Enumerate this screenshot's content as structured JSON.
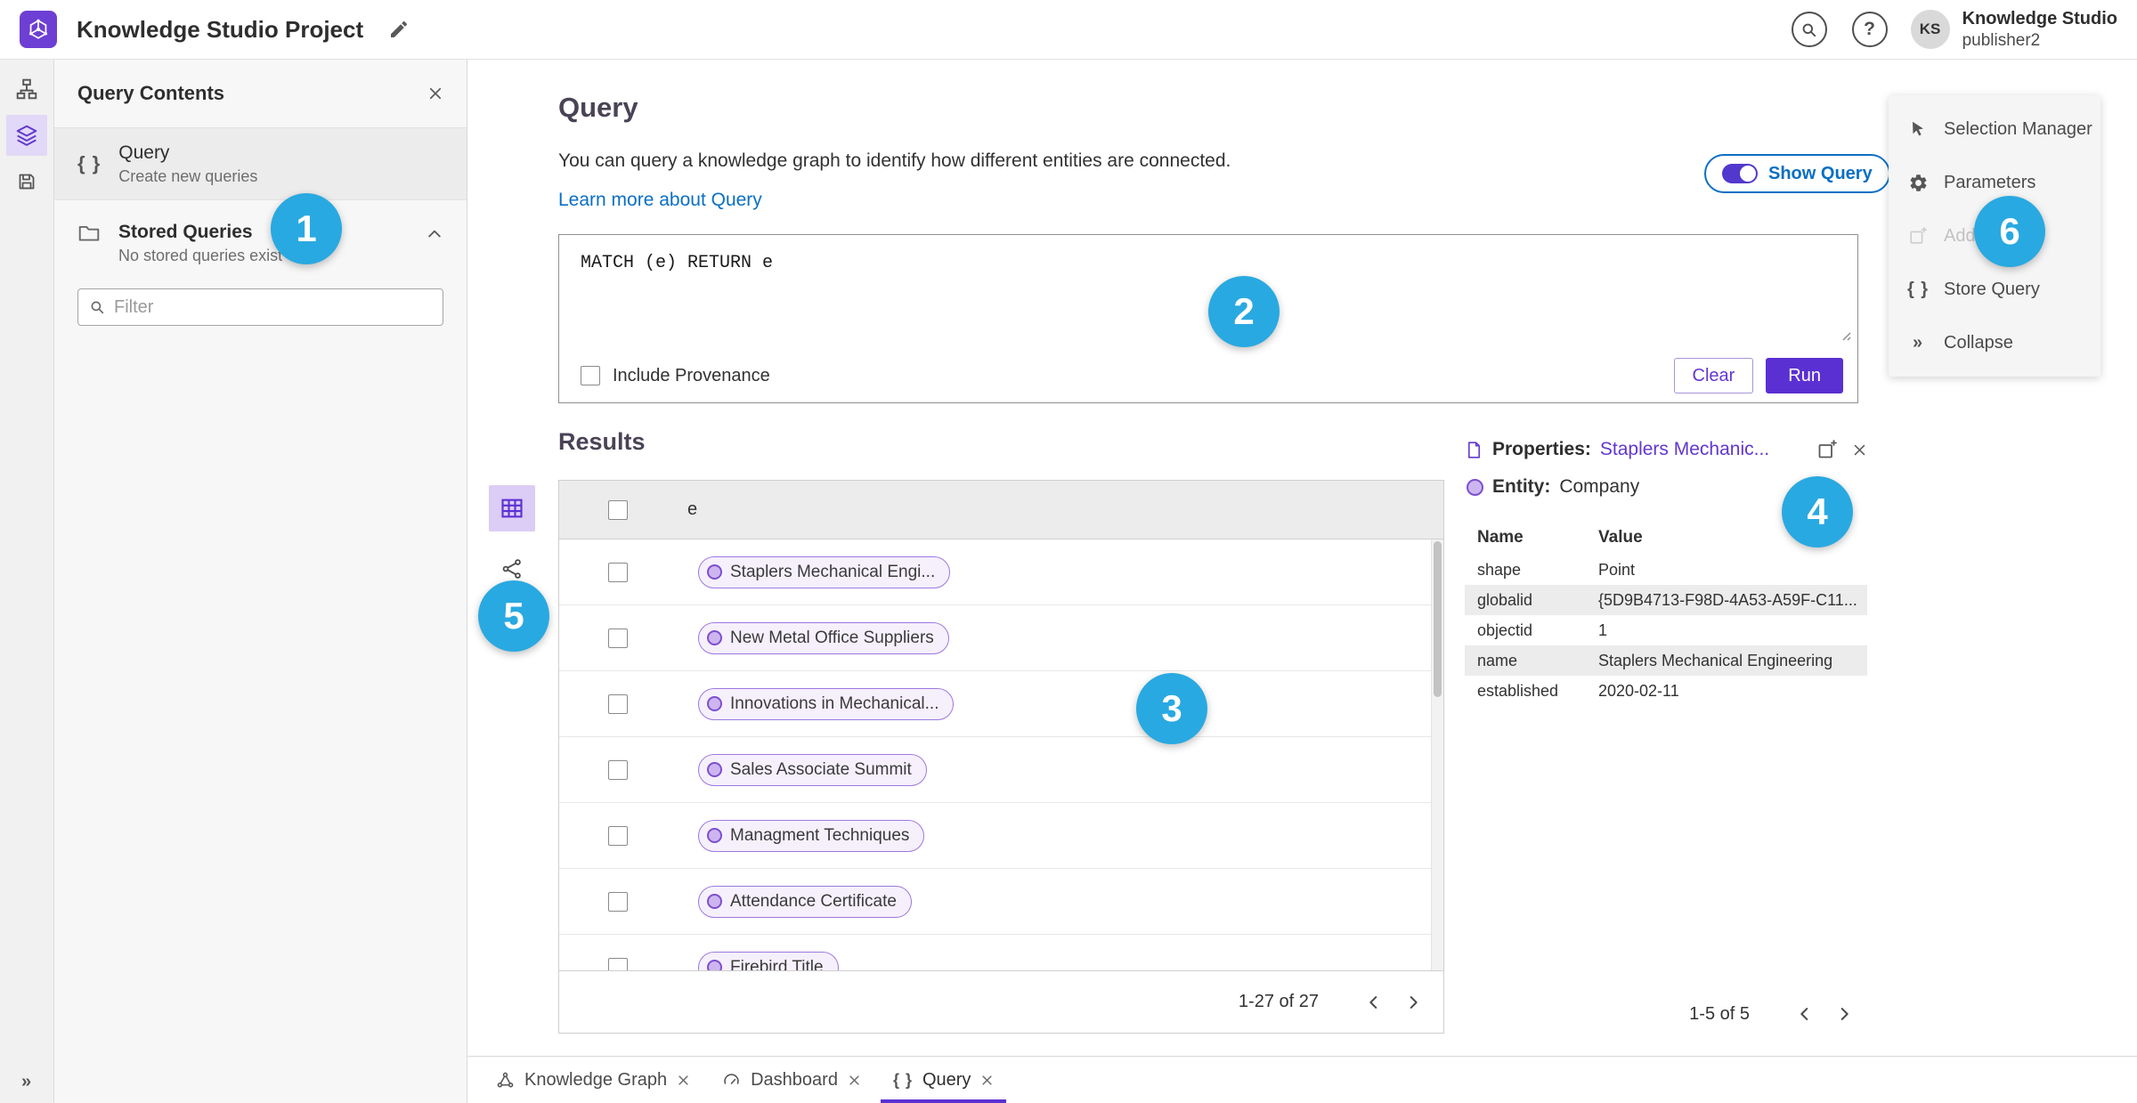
{
  "colors": {
    "accent_purple": "#5b30d2",
    "logo_purple": "#6d3fd4",
    "chip_border": "#9d78e2",
    "chip_background": "#f6f0fd",
    "link_blue": "#0b6fc2",
    "badge_blue": "#29a9e1",
    "panel_gray": "#f7f7f7"
  },
  "icons": {
    "help": "?",
    "braces": "{ }",
    "collapse": "»"
  },
  "header": {
    "title": "Knowledge Studio Project",
    "avatar_initials": "KS",
    "account_name": "Knowledge Studio",
    "account_role": "publisher2"
  },
  "query_contents": {
    "title": "Query Contents",
    "query_item_label": "Query",
    "query_item_sublabel": "Create new queries",
    "stored_label": "Stored Queries",
    "stored_sublabel": "No stored queries exist",
    "filter_placeholder": "Filter"
  },
  "query_panel": {
    "title": "Query",
    "description": "You can query a knowledge graph to identify how different entities are connected.",
    "learn_more": "Learn more about Query",
    "show_query": "Show Query",
    "query_text": "MATCH (e) RETURN e",
    "include_provenance": "Include Provenance",
    "clear": "Clear",
    "run": "Run"
  },
  "results": {
    "title": "Results",
    "column": "e",
    "rows": [
      "Staplers Mechanical Engi...",
      "New Metal Office Suppliers",
      "Innovations in Mechanical...",
      "Sales Associate Summit",
      "Managment Techniques",
      "Attendance Certificate",
      "Firebird Title"
    ],
    "pagination": "1-27 of 27"
  },
  "properties": {
    "label": "Properties:",
    "selected": "Staplers Mechanic...",
    "entity_label": "Entity:",
    "entity_type": "Company",
    "name_col": "Name",
    "value_col": "Value",
    "rows": [
      {
        "name": "shape",
        "value": "Point"
      },
      {
        "name": "globalid",
        "value": "{5D9B4713-F98D-4A53-A59F-C11..."
      },
      {
        "name": "objectid",
        "value": "1"
      },
      {
        "name": "name",
        "value": "Staplers Mechanical Engineering"
      },
      {
        "name": "established",
        "value": "2020-02-11"
      }
    ],
    "pagination": "1-5 of 5"
  },
  "tools": {
    "items": [
      {
        "label": "Selection Manager"
      },
      {
        "label": "Parameters"
      },
      {
        "label": "Add To Map"
      },
      {
        "label": "Store Query"
      },
      {
        "label": "Collapse"
      }
    ]
  },
  "tabs": [
    {
      "label": "Knowledge Graph"
    },
    {
      "label": "Dashboard"
    },
    {
      "label": "Query"
    }
  ],
  "annotations": [
    "1",
    "2",
    "3",
    "4",
    "5",
    "6"
  ]
}
